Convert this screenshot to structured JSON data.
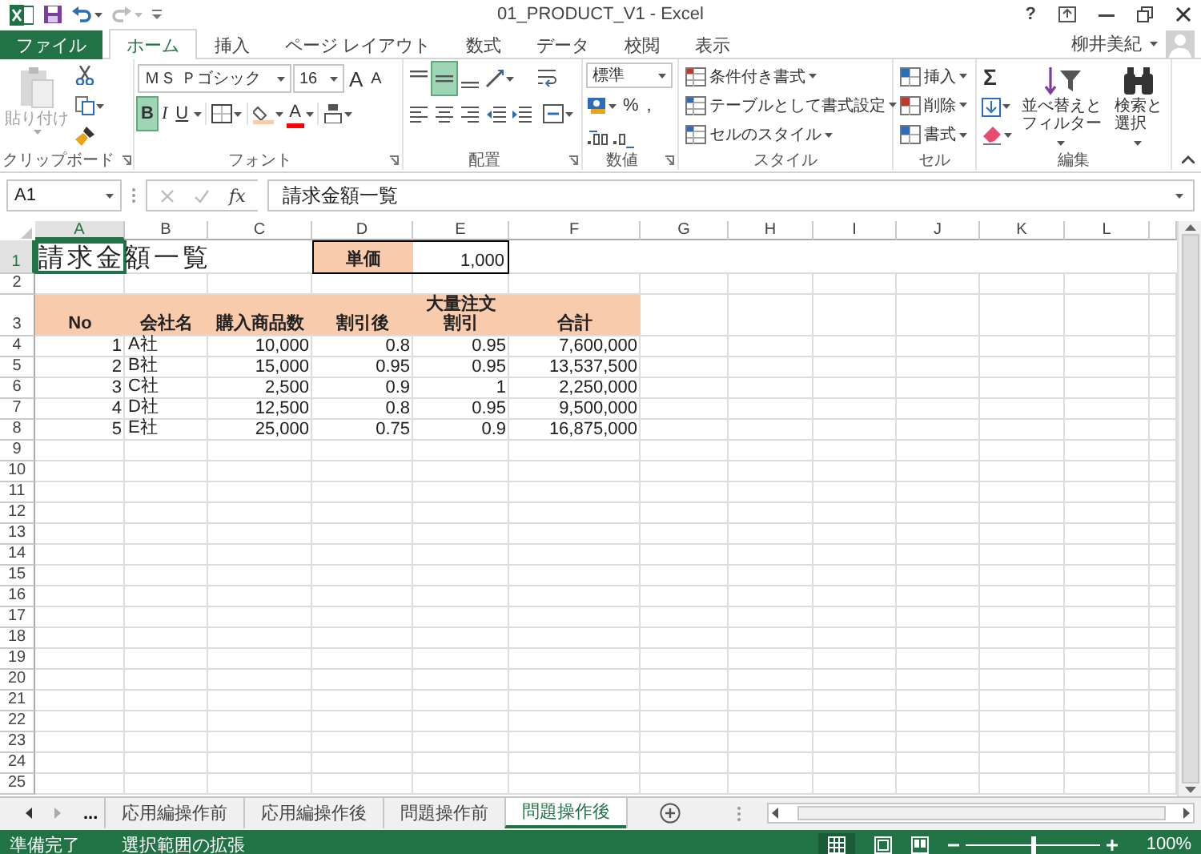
{
  "window": {
    "title": "01_PRODUCT_V1 - Excel",
    "help": "?",
    "user": "柳井美紀"
  },
  "tabs": [
    {
      "label": "ファイル",
      "kind": "file",
      "selected": false
    },
    {
      "label": "ホーム",
      "kind": "tab",
      "selected": true
    },
    {
      "label": "挿入",
      "kind": "tab",
      "selected": false
    },
    {
      "label": "ページ レイアウト",
      "kind": "tab",
      "selected": false
    },
    {
      "label": "数式",
      "kind": "tab",
      "selected": false
    },
    {
      "label": "データ",
      "kind": "tab",
      "selected": false
    },
    {
      "label": "校閲",
      "kind": "tab",
      "selected": false
    },
    {
      "label": "表示",
      "kind": "tab",
      "selected": false
    }
  ],
  "ribbon": {
    "clipboard": {
      "label": "クリップボード",
      "paste": {
        "label": "貼り付け",
        "disabled": true
      }
    },
    "font": {
      "label": "フォント",
      "name": "ＭＳ Ｐゴシック",
      "size": "16",
      "size_buttons": [
        "A",
        "A"
      ],
      "styles": [
        {
          "label": "B",
          "selected": true
        },
        {
          "label": "I",
          "selected": false
        },
        {
          "label": "U",
          "selected": false
        }
      ],
      "font_color": "A"
    },
    "alignment": {
      "label": "配置",
      "vertical": [
        {
          "selected": false
        },
        {
          "selected": true
        },
        {
          "selected": false
        }
      ]
    },
    "number": {
      "label": "数値",
      "format": "標準",
      "symbols": [
        "%",
        ","
      ]
    },
    "styles": {
      "label": "スタイル",
      "commands": [
        "条件付き書式",
        "テーブルとして書式設定",
        "セルのスタイル"
      ]
    },
    "cells": {
      "label": "セル",
      "commands": [
        "挿入",
        "削除",
        "書式"
      ]
    },
    "editing": {
      "label": "編集",
      "sum": "Σ",
      "commands": [
        "並べ替えとフィルター",
        "検索と選択"
      ]
    }
  },
  "formula_bar": {
    "name_box": "A1",
    "function_label": "fx",
    "formula": "請求金額一覧"
  },
  "sheet": {
    "columns": [
      {
        "label": "A",
        "selected": true
      },
      {
        "label": "B",
        "selected": false
      },
      {
        "label": "C",
        "selected": false
      },
      {
        "label": "D",
        "selected": false
      },
      {
        "label": "E",
        "selected": false
      },
      {
        "label": "F",
        "selected": false
      },
      {
        "label": "G",
        "selected": false
      },
      {
        "label": "H",
        "selected": false
      },
      {
        "label": "I",
        "selected": false
      },
      {
        "label": "J",
        "selected": false
      },
      {
        "label": "K",
        "selected": false
      },
      {
        "label": "L",
        "selected": false
      }
    ],
    "rows": [
      {
        "label": "1",
        "selected": true
      },
      {
        "label": "2",
        "selected": false
      },
      {
        "label": "3",
        "selected": false
      },
      {
        "label": "4",
        "selected": false
      },
      {
        "label": "5",
        "selected": false
      },
      {
        "label": "6",
        "selected": false
      },
      {
        "label": "7",
        "selected": false
      },
      {
        "label": "8",
        "selected": false
      },
      {
        "label": "9",
        "selected": false
      },
      {
        "label": "10",
        "selected": false
      },
      {
        "label": "11",
        "selected": false
      },
      {
        "label": "12",
        "selected": false
      },
      {
        "label": "13",
        "selected": false
      },
      {
        "label": "14",
        "selected": false
      },
      {
        "label": "15",
        "selected": false
      },
      {
        "label": "16",
        "selected": false
      },
      {
        "label": "17",
        "selected": false
      },
      {
        "label": "18",
        "selected": false
      },
      {
        "label": "19",
        "selected": false
      },
      {
        "label": "20",
        "selected": false
      },
      {
        "label": "21",
        "selected": false
      },
      {
        "label": "22",
        "selected": false
      },
      {
        "label": "23",
        "selected": false
      },
      {
        "label": "24",
        "selected": false
      },
      {
        "label": "25",
        "selected": false
      }
    ],
    "title": "請求金額一覧",
    "unit_price": {
      "label": "単価",
      "value": "1,000"
    },
    "table": {
      "headers": [
        "No",
        "会社名",
        "購入商品数",
        "割引後",
        "大量注文割引",
        "合計"
      ],
      "rows": [
        [
          "1",
          "A社",
          "10,000",
          "0.8",
          "0.95",
          "7,600,000"
        ],
        [
          "2",
          "B社",
          "15,000",
          "0.95",
          "0.95",
          "13,537,500"
        ],
        [
          "3",
          "C社",
          "2,500",
          "0.9",
          "1",
          "2,250,000"
        ],
        [
          "4",
          "D社",
          "12,500",
          "0.8",
          "0.95",
          "9,500,000"
        ],
        [
          "5",
          "E社",
          "25,000",
          "0.75",
          "0.9",
          "16,875,000"
        ]
      ]
    }
  },
  "sheet_tabs": {
    "more": "...",
    "tabs": [
      {
        "label": "応用編操作前",
        "selected": false
      },
      {
        "label": "応用編操作後",
        "selected": false
      },
      {
        "label": "問題操作前",
        "selected": false
      },
      {
        "label": "問題操作後",
        "selected": true
      }
    ]
  },
  "status_bar": {
    "ready": "準備完了",
    "mode": "選択範囲の拡張",
    "zoom": {
      "level": 0.5,
      "reading": "100%"
    }
  }
}
